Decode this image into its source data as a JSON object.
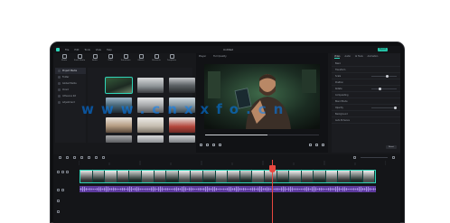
{
  "titlebar": {
    "menus": [
      "File",
      "Edit",
      "Tools",
      "View",
      "Help"
    ],
    "project_name": "Untitled",
    "export_label": "Export"
  },
  "toolbar": {
    "tools": [
      "Media",
      "Stock Media",
      "Audio",
      "Titles",
      "Transitions",
      "Effects",
      "Elements",
      "Templates"
    ]
  },
  "sidebar": {
    "items": [
      "Project Media",
      "Folder",
      "Global Media",
      "Cloud",
      "Influence Kit",
      "Adjustment"
    ]
  },
  "player": {
    "tabs": [
      "Player",
      "Full Quality"
    ],
    "progress": 0.55
  },
  "inspector": {
    "tabs": [
      "Video",
      "Audio",
      "AI Tools",
      "Animation"
    ],
    "rows": [
      "Basic",
      "Transform",
      "Scale",
      "Position",
      "Rotate",
      "Compositing",
      "Blend Mode",
      "Opacity",
      "Background",
      "Auto Enhance"
    ],
    "reset_label": "Reset"
  },
  "watermark": "www.cnxxfo.cn",
  "colors": {
    "accent": "#2fd4b8",
    "playhead": "#e8473f",
    "video_clip": "#1c6f66",
    "audio_clip": "#6a3fb1"
  }
}
